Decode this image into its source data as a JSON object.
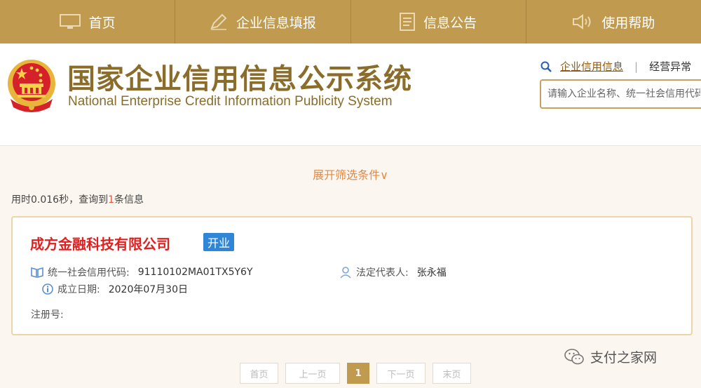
{
  "nav": {
    "items": [
      {
        "label": "首页",
        "icon": "monitor-icon"
      },
      {
        "label": "企业信息填报",
        "icon": "pen-icon"
      },
      {
        "label": "信息公告",
        "icon": "document-icon"
      },
      {
        "label": "使用帮助",
        "icon": "speaker-icon"
      }
    ]
  },
  "header": {
    "title_cn": "国家企业信用信息公示系统",
    "title_en": "National Enterprise Credit Information Publicity System",
    "search_tab_active": "企业信用信息",
    "search_tab_other": "经营异常",
    "search_placeholder": "请输入企业名称、统一社会信用代码"
  },
  "filter": {
    "toggle_label": "展开筛选条件∨"
  },
  "result": {
    "prefix": "用时0.016秒，查询到",
    "count": "1",
    "suffix": "条信息"
  },
  "company": {
    "name": "成方金融科技有限公司",
    "status": "开业",
    "credit_code_label": "统一社会信用代码:",
    "credit_code": "91110102MA01TX5Y6Y",
    "legal_rep_label": "法定代表人:",
    "legal_rep": "张永福",
    "established_label": "成立日期:",
    "established": "2020年07月30日",
    "reg_no_label": "注册号:",
    "reg_no": ""
  },
  "pagination": {
    "first": "首页",
    "prev": "上一页",
    "current": "1",
    "next": "下一页",
    "last": "末页"
  },
  "watermark": {
    "text": "支付之家网"
  },
  "colors": {
    "nav_bg": "#c09b4f",
    "title": "#8a6d2b",
    "company_name": "#e02020",
    "status_badge": "#2f86d6",
    "filter": "#e38a46"
  }
}
